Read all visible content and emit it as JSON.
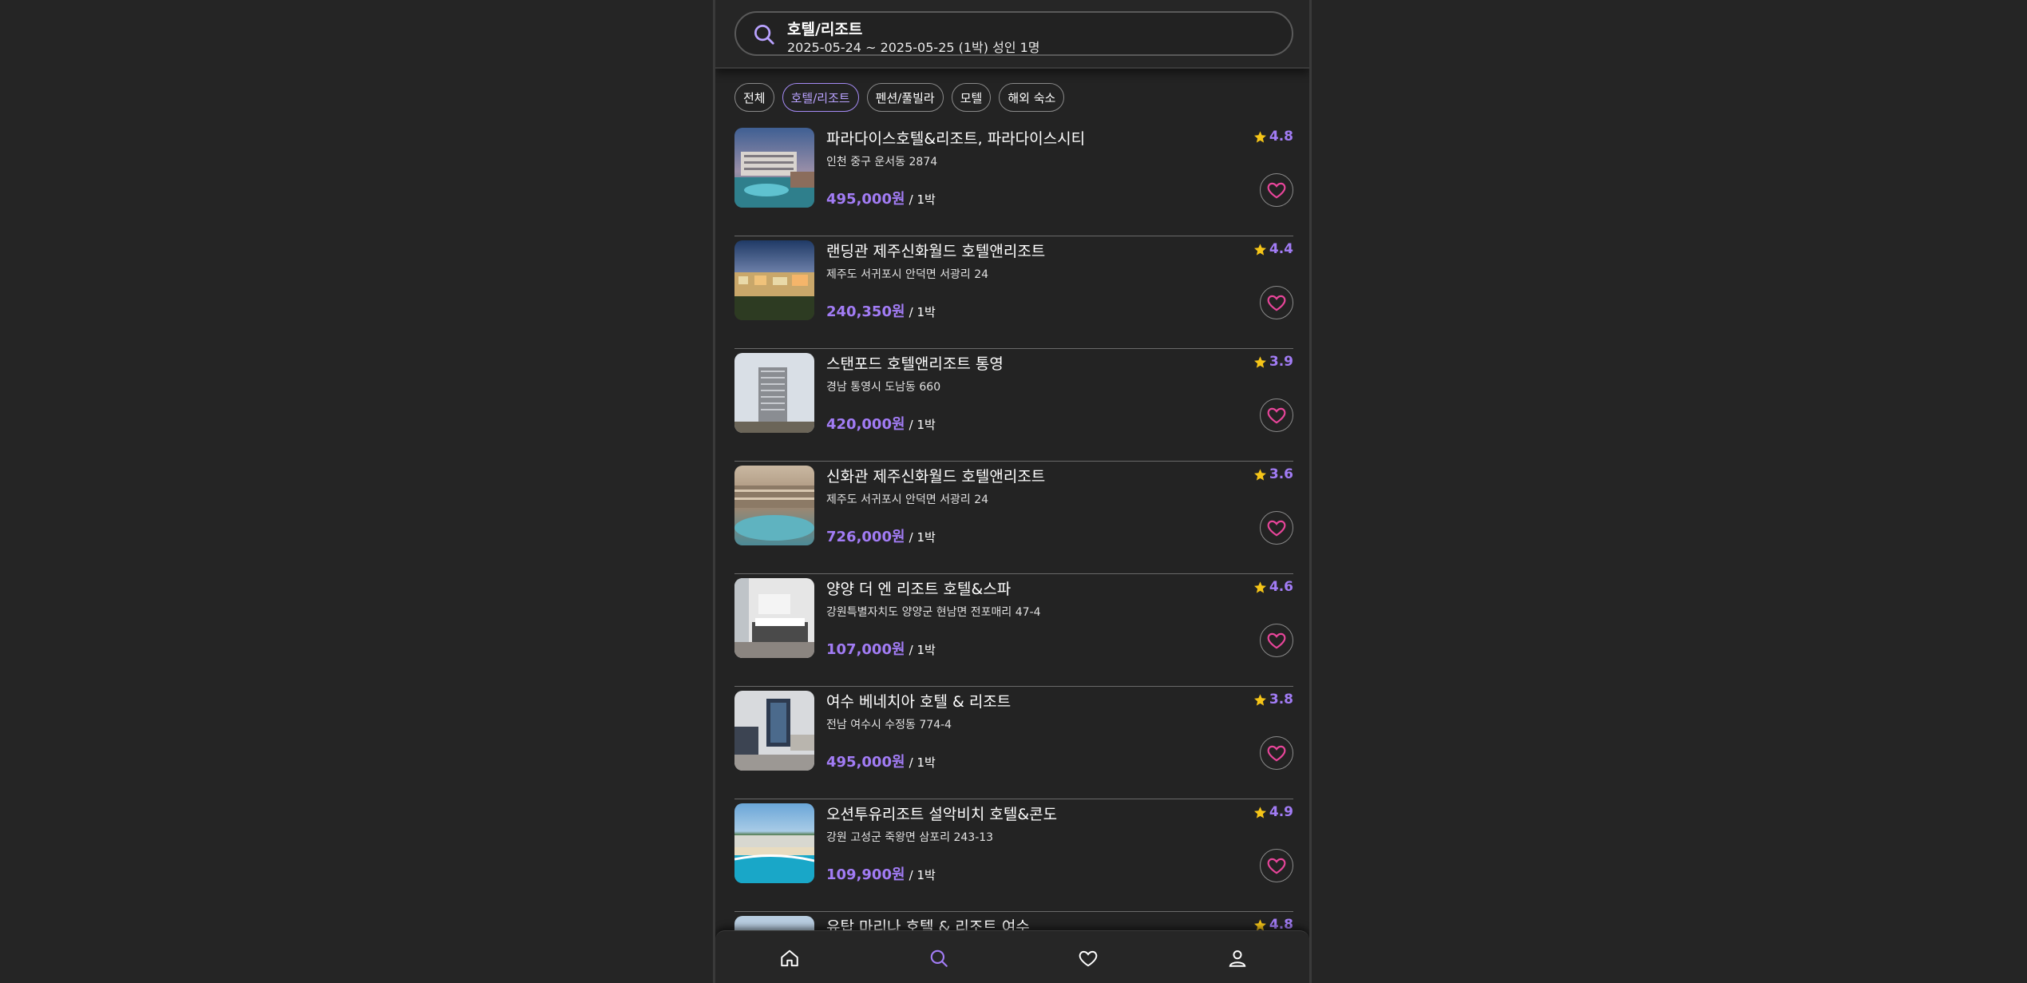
{
  "search": {
    "title": "호텔/리조트",
    "subtitle": "2025-05-24 ~ 2025-05-25 (1박) 성인 1명",
    "icon": "search-icon"
  },
  "chips": [
    "전체",
    "호텔/리조트",
    "펜션/풀빌라",
    "모텔",
    "해외 숙소"
  ],
  "active_chip": "호텔/리조트",
  "per_night": "/ 1박",
  "items": [
    {
      "name": "파라다이스호텔&리조트, 파라다이스시티",
      "address": "인천 중구 운서동 2874",
      "price": "495,000원",
      "rating": "4.8"
    },
    {
      "name": "랜딩관 제주신화월드 호텔앤리조트",
      "address": "제주도 서귀포시 안덕면 서광리 24",
      "price": "240,350원",
      "rating": "4.4"
    },
    {
      "name": "스탠포드 호텔앤리조트 통영",
      "address": "경남 통영시 도남동 660",
      "price": "420,000원",
      "rating": "3.9"
    },
    {
      "name": "신화관 제주신화월드 호텔앤리조트",
      "address": "제주도 서귀포시 안덕면 서광리 24",
      "price": "726,000원",
      "rating": "3.6"
    },
    {
      "name": "양양 더 엔 리조트 호텔&스파",
      "address": "강원특별자치도 양양군 현남면 전포매리 47-4",
      "price": "107,000원",
      "rating": "4.6"
    },
    {
      "name": "여수 베네치아 호텔 & 리조트",
      "address": "전남 여수시 수정동 774-4",
      "price": "495,000원",
      "rating": "3.8"
    },
    {
      "name": "오션투유리조트 설악비치 호텔&콘도",
      "address": "강원 고성군 죽왕면 삼포리 243-13",
      "price": "109,900원",
      "rating": "4.9"
    },
    {
      "name": "유탑 마리나 호텔 & 리조트 여수",
      "address": "",
      "price": "",
      "rating": "4.8"
    }
  ],
  "nav": [
    "home-icon",
    "search-icon",
    "heart-icon",
    "user-icon"
  ],
  "colors": {
    "accent": "#a27cf5",
    "star": "#f5c518",
    "heart": "#e8459a",
    "background": "#232323"
  }
}
